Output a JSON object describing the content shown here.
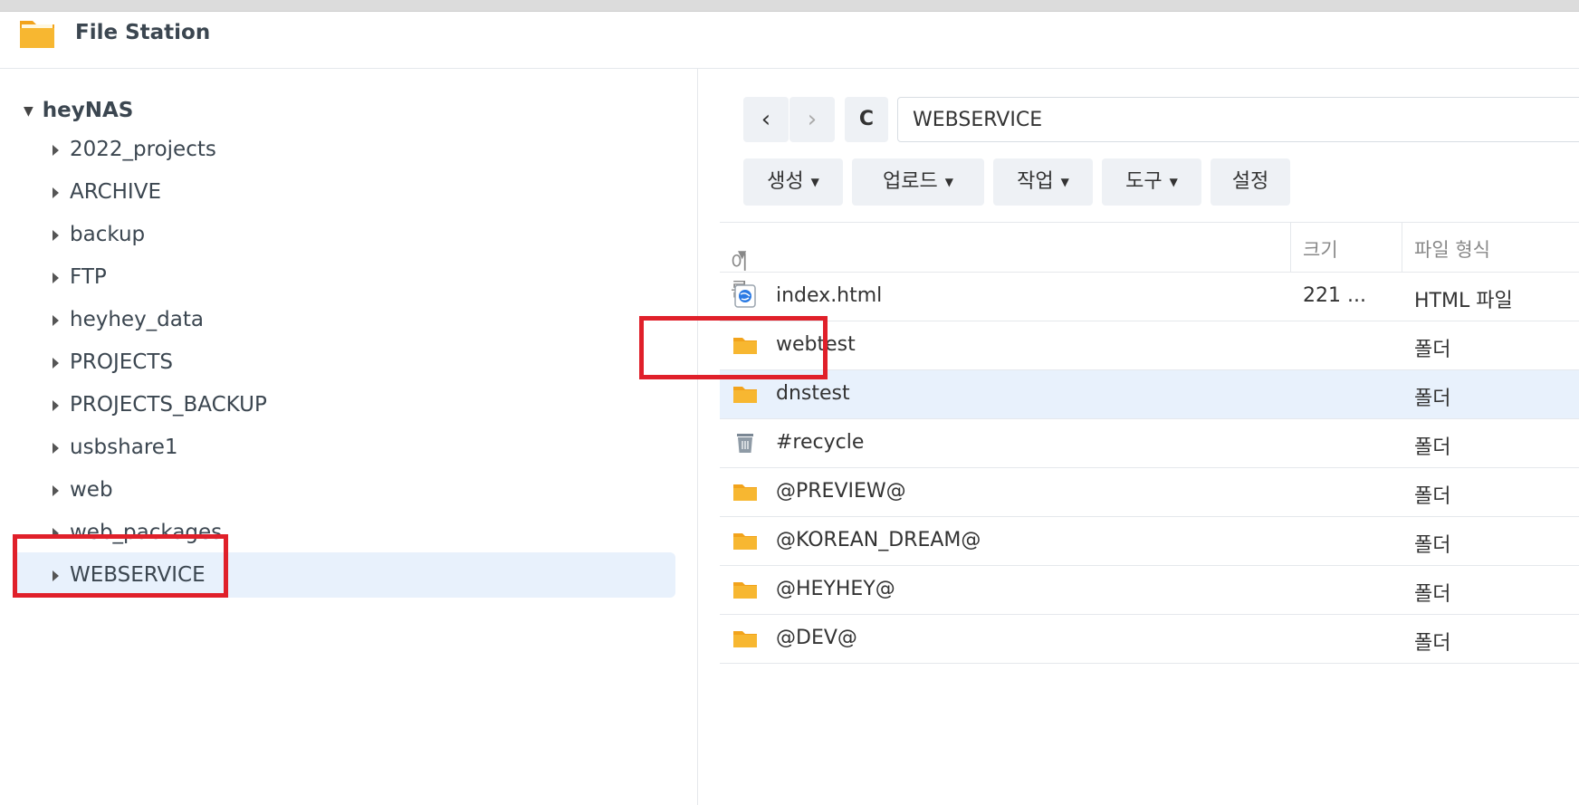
{
  "window": {
    "title": "File Station"
  },
  "sidebar": {
    "root": "heyNAS",
    "items": [
      {
        "label": "2022_projects"
      },
      {
        "label": "ARCHIVE"
      },
      {
        "label": "backup"
      },
      {
        "label": "FTP"
      },
      {
        "label": "heyhey_data"
      },
      {
        "label": "PROJECTS"
      },
      {
        "label": "PROJECTS_BACKUP"
      },
      {
        "label": "usbshare1"
      },
      {
        "label": "web"
      },
      {
        "label": "web_packages"
      },
      {
        "label": "WEBSERVICE"
      }
    ],
    "selected": "WEBSERVICE"
  },
  "nav": {
    "back": "‹",
    "forward": "›",
    "refresh": "C",
    "path": "WEBSERVICE"
  },
  "toolbar": {
    "create": "생성",
    "upload": "업로드",
    "action": "작업",
    "tools": "도구",
    "settings": "설정"
  },
  "table": {
    "headers": {
      "name": "이름",
      "size": "크기",
      "type": "파일 형식"
    },
    "rows": [
      {
        "name": "index.html",
        "size": "221 ...",
        "type": "HTML 파일",
        "icon": "html-file-icon"
      },
      {
        "name": "webtest",
        "size": "",
        "type": "폴더",
        "icon": "folder-icon"
      },
      {
        "name": "dnstest",
        "size": "",
        "type": "폴더",
        "icon": "folder-icon"
      },
      {
        "name": "#recycle",
        "size": "",
        "type": "폴더",
        "icon": "recycle-bin-icon"
      },
      {
        "name": "@PREVIEW@",
        "size": "",
        "type": "폴더",
        "icon": "folder-icon"
      },
      {
        "name": "@KOREAN_DREAM@",
        "size": "",
        "type": "폴더",
        "icon": "folder-icon"
      },
      {
        "name": "@HEYHEY@",
        "size": "",
        "type": "폴더",
        "icon": "folder-icon"
      },
      {
        "name": "@DEV@",
        "size": "",
        "type": "폴더",
        "icon": "folder-icon"
      }
    ],
    "selected_row": "dnstest"
  },
  "colors": {
    "highlight": "#e0202a",
    "selection": "#e8f1fc",
    "folder": "#f7b731"
  }
}
